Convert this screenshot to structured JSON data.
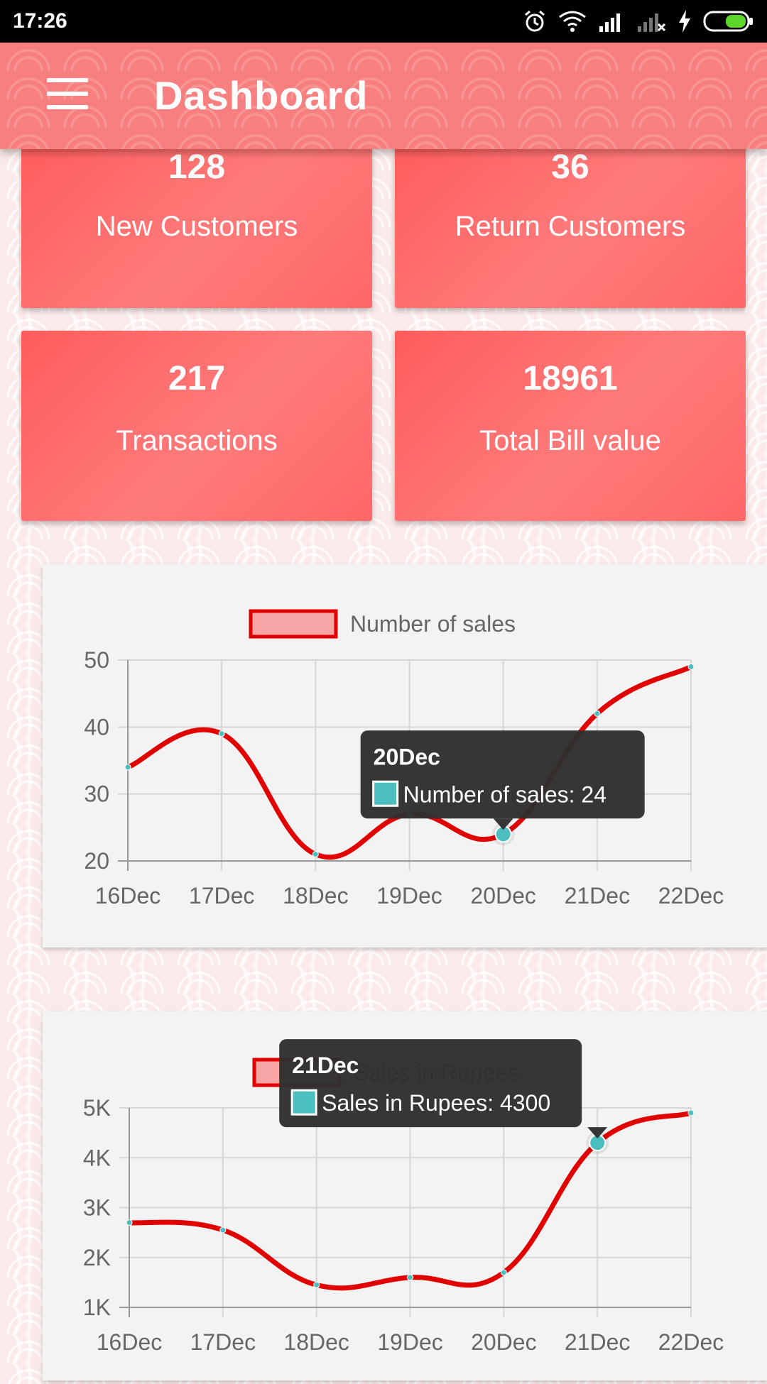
{
  "status_bar": {
    "time": "17:26"
  },
  "app_bar": {
    "title": "Dashboard"
  },
  "stats": [
    {
      "value": "128",
      "label": "New Customers"
    },
    {
      "value": "36",
      "label": "Return Customers"
    },
    {
      "value": "217",
      "label": "Transactions"
    },
    {
      "value": "18961",
      "label": "Total Bill value"
    }
  ],
  "colors": {
    "line": "#e00000",
    "point": "#4bbfc0",
    "tooltip_bg": "#2e2e2e"
  },
  "chart_data": [
    {
      "type": "line",
      "categories": [
        "16Dec",
        "17Dec",
        "18Dec",
        "19Dec",
        "20Dec",
        "21Dec",
        "22Dec"
      ],
      "series": [
        {
          "name": "Number of sales",
          "values": [
            34,
            39,
            21,
            27,
            24,
            42,
            49
          ]
        }
      ],
      "ylim": [
        20,
        50
      ],
      "yticks": [
        "20",
        "30",
        "40",
        "50"
      ],
      "legend": "top-center",
      "grid": true,
      "tooltip": {
        "index": 4,
        "title": "20Dec",
        "text": "Number of sales: 24"
      }
    },
    {
      "type": "line",
      "categories": [
        "16Dec",
        "17Dec",
        "18Dec",
        "19Dec",
        "20Dec",
        "21Dec",
        "22Dec"
      ],
      "series": [
        {
          "name": "Sales in Rupees",
          "values": [
            2700,
            2550,
            1450,
            1600,
            1700,
            4300,
            4900
          ]
        }
      ],
      "ylim": [
        1000,
        5000
      ],
      "yticks": [
        "1K",
        "2K",
        "3K",
        "4K",
        "5K"
      ],
      "legend": "top-center",
      "grid": true,
      "tooltip": {
        "index": 5,
        "title": "21Dec",
        "text": "Sales in Rupees: 4300"
      }
    }
  ]
}
